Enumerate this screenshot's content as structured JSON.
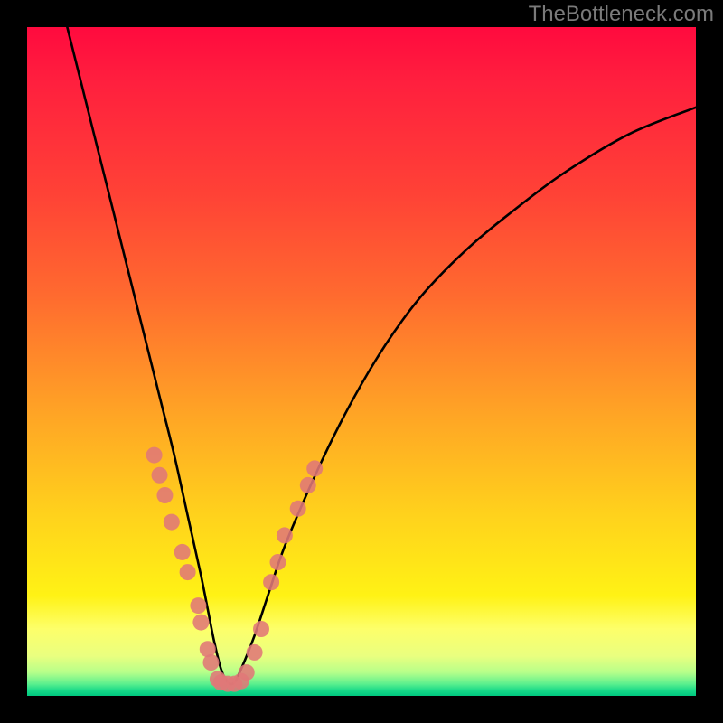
{
  "watermark": {
    "text": "TheBottleneck.com"
  },
  "chart_data": {
    "type": "line",
    "title": "",
    "xlabel": "",
    "ylabel": "",
    "xlim": [
      0,
      100
    ],
    "ylim": [
      0,
      100
    ],
    "series": [
      {
        "name": "curve",
        "x": [
          6,
          8,
          10,
          12,
          14,
          16,
          18,
          20,
          22,
          24,
          26,
          27,
          28,
          29,
          30,
          31,
          32,
          34,
          36,
          38,
          40,
          44,
          48,
          52,
          56,
          60,
          66,
          72,
          80,
          90,
          100
        ],
        "y": [
          100,
          92,
          84,
          76,
          68,
          60,
          52,
          44,
          36,
          27,
          18,
          13,
          8,
          4,
          2,
          2,
          4,
          9,
          15,
          21,
          26,
          35,
          43,
          50,
          56,
          61,
          67,
          72,
          78,
          84,
          88
        ]
      }
    ],
    "markers": {
      "name": "highlight-dots",
      "color": "#e07878",
      "radius_px": 9,
      "points": [
        {
          "x": 19.0,
          "y": 36.0
        },
        {
          "x": 19.8,
          "y": 33.0
        },
        {
          "x": 20.6,
          "y": 30.0
        },
        {
          "x": 21.6,
          "y": 26.0
        },
        {
          "x": 23.2,
          "y": 21.5
        },
        {
          "x": 24.0,
          "y": 18.5
        },
        {
          "x": 25.6,
          "y": 13.5
        },
        {
          "x": 26.0,
          "y": 11.0
        },
        {
          "x": 27.0,
          "y": 7.0
        },
        {
          "x": 27.5,
          "y": 5.0
        },
        {
          "x": 28.5,
          "y": 2.5
        },
        {
          "x": 29.0,
          "y": 2.0
        },
        {
          "x": 30.0,
          "y": 1.8
        },
        {
          "x": 31.0,
          "y": 1.8
        },
        {
          "x": 32.0,
          "y": 2.2
        },
        {
          "x": 32.8,
          "y": 3.5
        },
        {
          "x": 34.0,
          "y": 6.5
        },
        {
          "x": 35.0,
          "y": 10.0
        },
        {
          "x": 36.5,
          "y": 17.0
        },
        {
          "x": 37.5,
          "y": 20.0
        },
        {
          "x": 38.5,
          "y": 24.0
        },
        {
          "x": 40.5,
          "y": 28.0
        },
        {
          "x": 42.0,
          "y": 31.5
        },
        {
          "x": 43.0,
          "y": 34.0
        }
      ]
    },
    "gradient_stops": [
      {
        "offset": 0,
        "color": "#ff0a3e"
      },
      {
        "offset": 0.4,
        "color": "#ff6a2f"
      },
      {
        "offset": 0.73,
        "color": "#ffd21c"
      },
      {
        "offset": 0.9,
        "color": "#fdff6a"
      },
      {
        "offset": 0.985,
        "color": "#18d989"
      },
      {
        "offset": 1.0,
        "color": "#00c77f"
      }
    ]
  }
}
